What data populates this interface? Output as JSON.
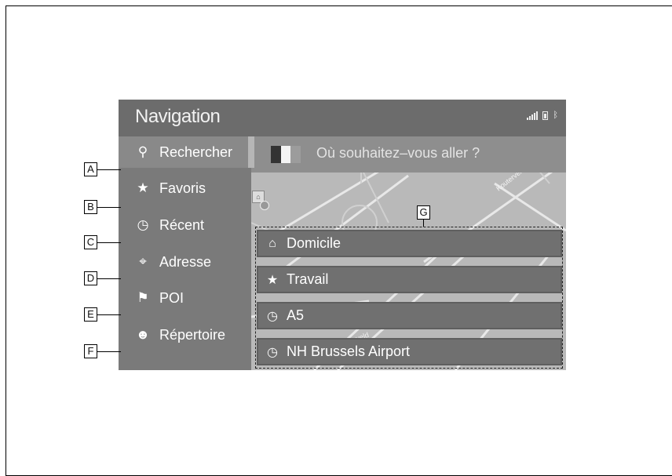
{
  "app": {
    "title": "Navigation"
  },
  "status": {
    "signal_icon": "signal-bars-icon",
    "battery_icon": "battery-icon",
    "bluetooth_icon": "bluetooth-icon"
  },
  "search": {
    "flag_colors": [
      "#333333",
      "#f4f4f4",
      "#9c9c9c"
    ],
    "placeholder": "Où souhaitez–vous aller ?"
  },
  "sidebar": {
    "items": [
      {
        "label": "Rechercher",
        "icon": "search-icon",
        "glyph": "🔍",
        "callout": "A",
        "active": true
      },
      {
        "label": "Favoris",
        "icon": "star-icon",
        "glyph": "★",
        "callout": "B"
      },
      {
        "label": "Récent",
        "icon": "clock-icon",
        "glyph": "◷",
        "callout": "C"
      },
      {
        "label": "Adresse",
        "icon": "address-pin-icon",
        "glyph": "⌖",
        "callout": "D"
      },
      {
        "label": "POI",
        "icon": "poi-pin-icon",
        "glyph": "⚲",
        "callout": "E"
      },
      {
        "label": "Répertoire",
        "icon": "contact-icon",
        "glyph": "👤",
        "callout": "F"
      }
    ]
  },
  "quick_list": {
    "callout": "G",
    "items": [
      {
        "label": "Domicile",
        "icon": "home-icon",
        "glyph": "⌂"
      },
      {
        "label": "Travail",
        "icon": "star-icon",
        "glyph": "★"
      },
      {
        "label": "A5",
        "icon": "clock-icon",
        "glyph": "◷"
      },
      {
        "label": "NH Brussels Airport",
        "icon": "clock-icon",
        "glyph": "◷"
      }
    ]
  },
  "map": {
    "street_label": "Kouterveld",
    "street_label2": "Kouterveld"
  }
}
